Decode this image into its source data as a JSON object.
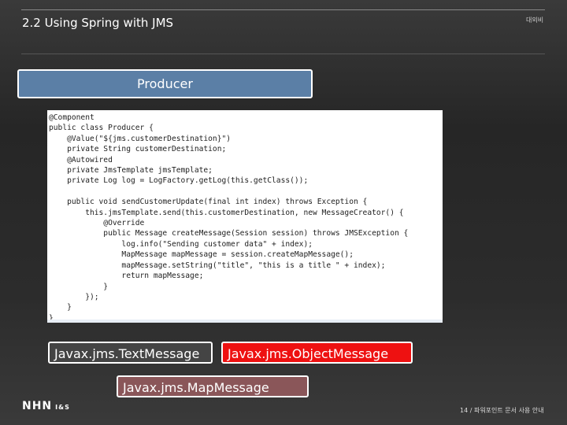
{
  "header": {
    "title": "2.2  Using Spring with JMS",
    "confidential": "대외비"
  },
  "producer_label": "Producer",
  "code": "@Component\npublic class Producer {\n    @Value(\"${jms.customerDestination}\")\n    private String customerDestination;\n    @Autowired\n    private JmsTemplate jmsTemplate;\n    private Log log = LogFactory.getLog(this.getClass());\n\n    public void sendCustomerUpdate(final int index) throws Exception {\n        this.jmsTemplate.send(this.customerDestination, new MessageCreator() {\n            @Override\n            public Message createMessage(Session session) throws JMSException {\n                log.info(\"Sending customer data\" + index);\n                MapMessage mapMessage = session.createMapMessage();\n                mapMessage.setString(\"title\", \"this is a title \" + index);\n                return mapMessage;\n            }\n        });\n    }\n}",
  "messages": [
    "Javax.jms.TextMessage",
    "Javax.jms.ObjectMessage",
    "Javax.jms.MapMessage"
  ],
  "footer": {
    "logo": "NHN",
    "logo_sub": "I&S",
    "page": "14 / 파워포인트 문서 사용 안내"
  }
}
